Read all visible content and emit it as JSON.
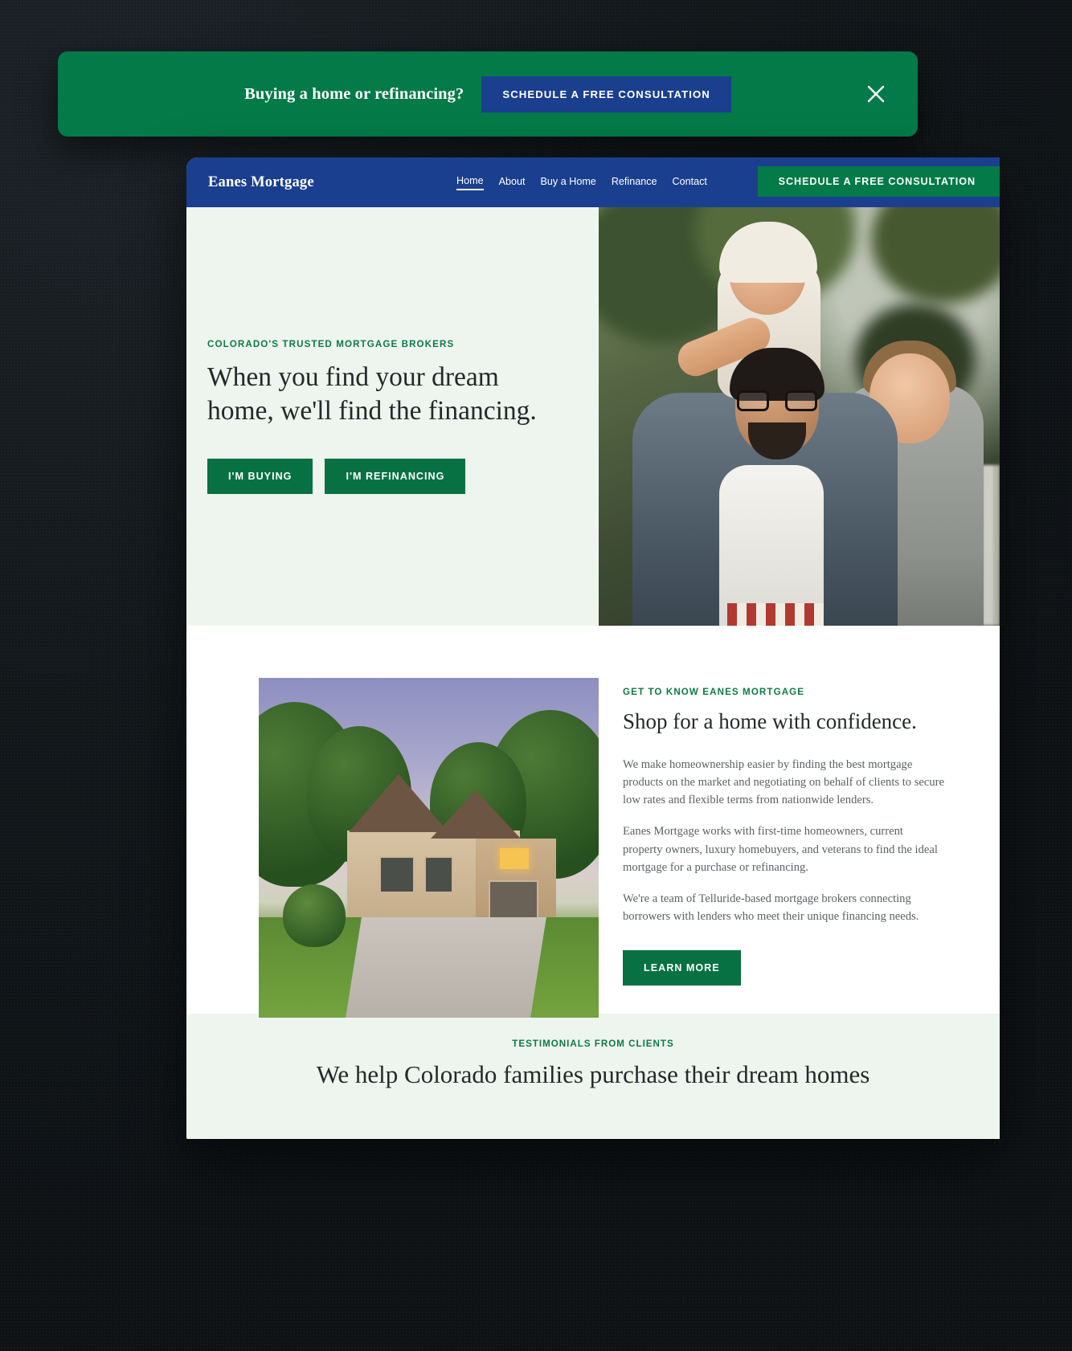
{
  "banner": {
    "text": "Buying a home or refinancing?",
    "cta_label": "SCHEDULE A FREE CONSULTATION",
    "close_icon": "close-icon"
  },
  "nav": {
    "logo": "Eanes Mortgage",
    "links": [
      {
        "label": "Home",
        "active": true
      },
      {
        "label": "About",
        "active": false
      },
      {
        "label": "Buy a Home",
        "active": false
      },
      {
        "label": "Refinance",
        "active": false
      },
      {
        "label": "Contact",
        "active": false
      }
    ],
    "cta_label": "SCHEDULE A FREE CONSULTATION"
  },
  "hero": {
    "eyebrow": "COLORADO'S TRUSTED MORTGAGE BROKERS",
    "title": "When you find your dream home, we'll find the financing.",
    "buttons": [
      {
        "label": "I'M BUYING"
      },
      {
        "label": "I'M REFINANCING"
      }
    ],
    "image_alt": "father-with-two-children-photo"
  },
  "about": {
    "eyebrow": "GET TO KNOW EANES MORTGAGE",
    "title": "Shop for a home with confidence.",
    "paragraphs": [
      "We make homeownership easier by finding the best mortgage products on the market and negotiating on behalf of clients to secure low rates and flexible terms from nationwide lenders.",
      "Eanes Mortgage works with first-time homeowners, current property owners, luxury homebuyers, and veterans to find the ideal mortgage for a purchase or refinancing.",
      "We're a team of Telluride-based mortgage brokers connecting borrowers with lenders who meet their unique financing needs."
    ],
    "cta_label": "LEARN MORE",
    "image_alt": "suburban-home-at-dusk-photo"
  },
  "testimonials": {
    "eyebrow": "TESTIMONIALS FROM CLIENTS",
    "title": "We help Colorado families purchase their dream homes"
  },
  "colors": {
    "brand_green": "#037a47",
    "brand_navy": "#1b3f8f",
    "button_green": "#077143",
    "tint_green": "#eef5ee",
    "eyebrow_green": "#0e7a47",
    "heading_dark": "#24292b",
    "body_gray": "#5d6164"
  }
}
